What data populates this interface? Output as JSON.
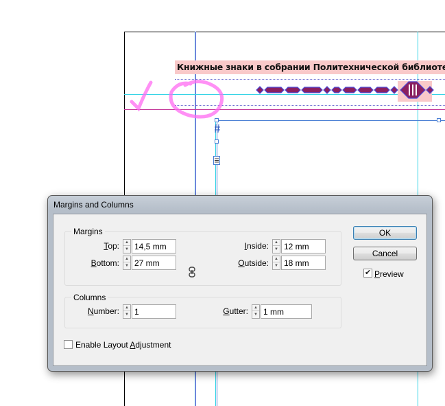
{
  "document": {
    "title_text": "Книжные знаки в собрании Политехнической библиотеки"
  },
  "dialog": {
    "title": "Margins and Columns",
    "margins": {
      "legend": "Margins",
      "top": {
        "label_pre": "",
        "label_mnemonic": "T",
        "label_post": "op:",
        "value": "14,5 mm"
      },
      "bottom": {
        "label_pre": "",
        "label_mnemonic": "B",
        "label_post": "ottom:",
        "value": "27 mm"
      },
      "inside": {
        "label_pre": "",
        "label_mnemonic": "I",
        "label_post": "nside:",
        "value": "12 mm"
      },
      "outside": {
        "label_pre": "",
        "label_mnemonic": "O",
        "label_post": "utside:",
        "value": "18 mm"
      },
      "link_icon": "chain-link-icon"
    },
    "columns": {
      "legend": "Columns",
      "number": {
        "label_pre": "",
        "label_mnemonic": "N",
        "label_post": "umber:",
        "value": "1"
      },
      "gutter": {
        "label_pre": "",
        "label_mnemonic": "G",
        "label_post": "utter:",
        "value": "1 mm"
      }
    },
    "enable_layout_adjustment": {
      "label_pre": "Enable Layout ",
      "label_mnemonic": "A",
      "label_post": "djustment",
      "checked": false
    },
    "buttons": {
      "ok": "OK",
      "cancel": "Cancel"
    },
    "preview": {
      "label_mnemonic": "P",
      "label_post": "review",
      "checked": true
    }
  },
  "colors": {
    "guide_cyan": "#35d4e6",
    "guide_purple": "#8e5bd6",
    "guide_magenta": "#c43a9a",
    "title_highlight": "#f9c9c9",
    "annotation_pink": "#ff6bf2",
    "frame_blue": "#4a7fd4"
  }
}
